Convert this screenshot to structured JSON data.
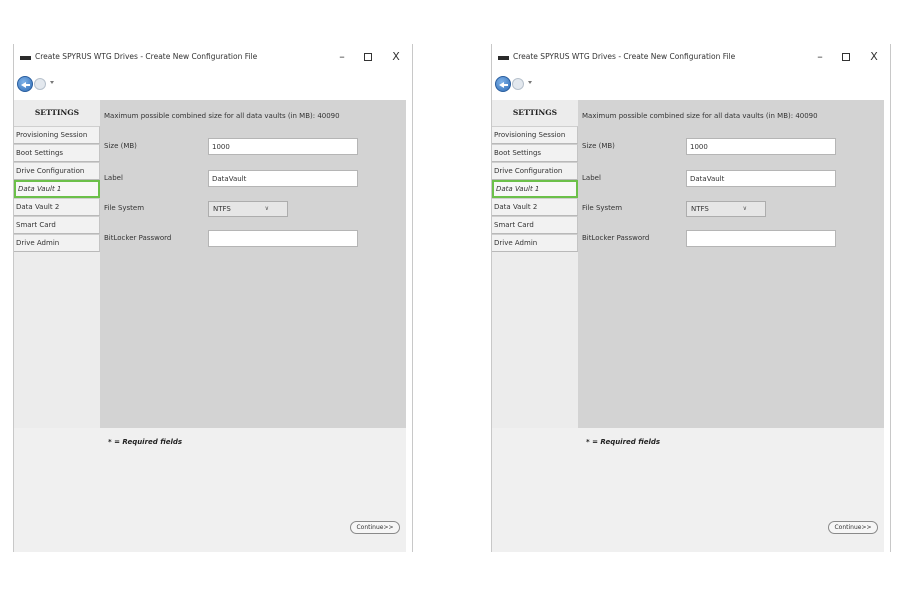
{
  "window": {
    "title": "Create SPYRUS WTG Drives - Create New Configuration File",
    "min_glyph": "–",
    "close_glyph": "X"
  },
  "sidebar": {
    "header": "SETTINGS",
    "items": [
      {
        "label": "Provisioning Session"
      },
      {
        "label": "Boot Settings"
      },
      {
        "label": "Drive Configuration"
      },
      {
        "label": "Data Vault 1",
        "active": true
      },
      {
        "label": "Data Vault 2"
      },
      {
        "label": "Smart Card"
      },
      {
        "label": "Drive Admin"
      }
    ]
  },
  "form": {
    "max_size_text": "Maximum possible combined size for all data vaults (in MB): 40090",
    "size_label": "Size (MB)",
    "size_value": "1000",
    "label_label": "Label",
    "label_value": "DataVault",
    "fs_label": "File System",
    "fs_value": "NTFS",
    "bitlocker_label": "BitLocker Password",
    "bitlocker_value": ""
  },
  "footer": {
    "required_note": "* = Required fields",
    "continue_label": "Continue>>"
  },
  "colors": {
    "active_border": "#6cc04a",
    "content_bg": "#d3d3d3",
    "sidebar_bg": "#ececec",
    "footer_bg": "#f0f0f0"
  },
  "icons": [
    "app-icon",
    "back-arrow-icon",
    "forward-arrow-icon",
    "dropdown-arrow-icon",
    "minimize-icon",
    "maximize-icon",
    "close-icon"
  ]
}
